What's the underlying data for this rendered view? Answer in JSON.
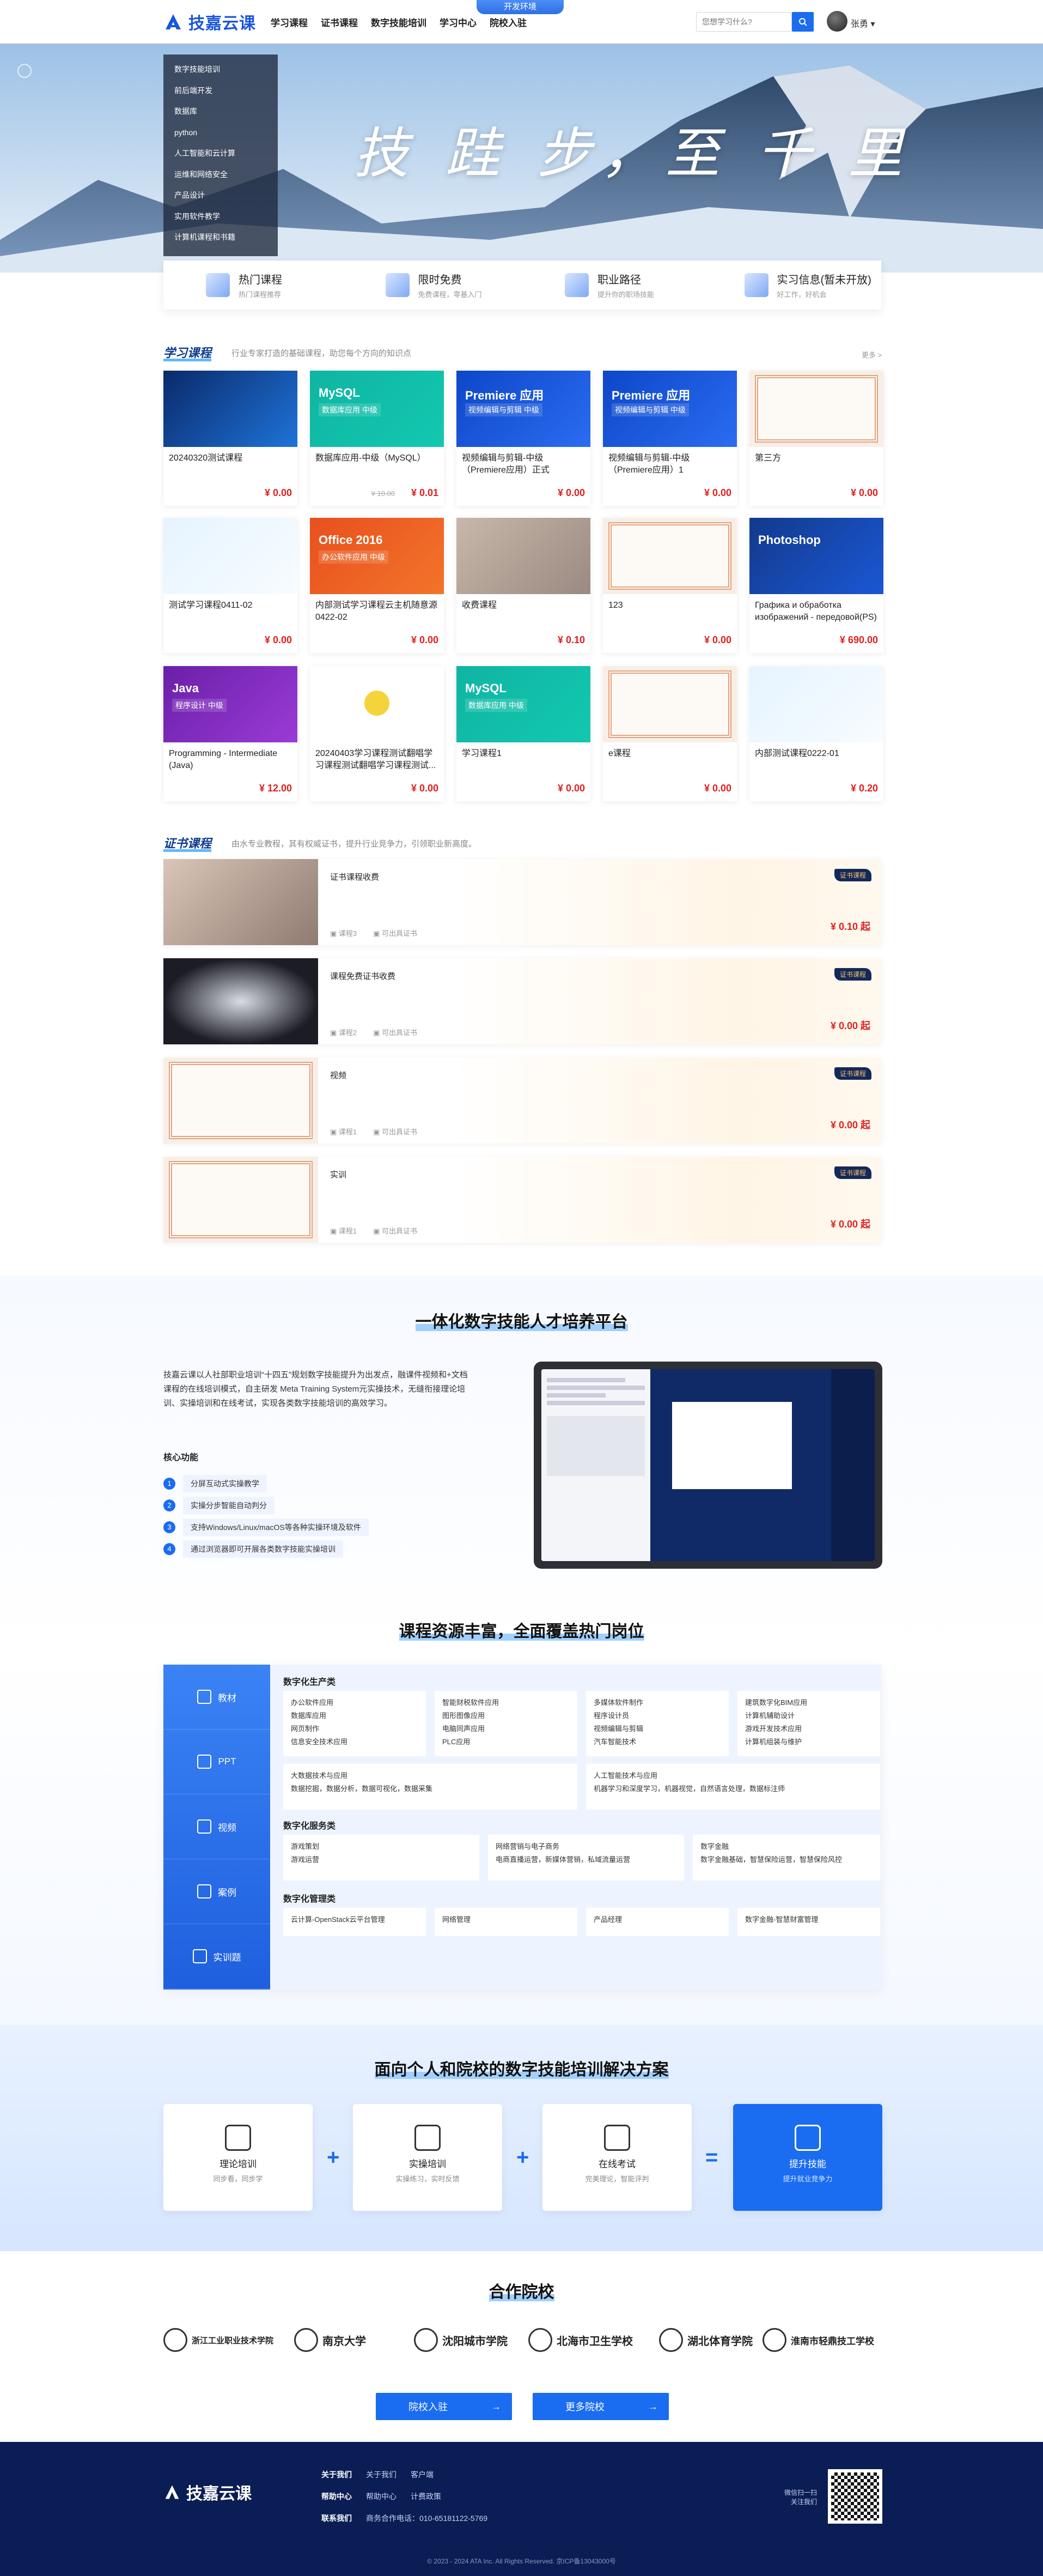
{
  "header": {
    "env_tag": "开发环境",
    "logo_text": "技嘉云课",
    "nav": [
      "学习课程",
      "证书课程",
      "数字技能培训",
      "学习中心",
      "院校入驻"
    ],
    "search_placeholder": "您想学习什么?",
    "user_name": "张勇"
  },
  "banner": {
    "title": "技 跬 步，至 千 里",
    "side_menu": [
      "数字技能培训",
      "前后端开发",
      "数据库",
      "python",
      "人工智能和云计算",
      "运维和网络安全",
      "产品设计",
      "实用软件教学",
      "计算机课程和书籍"
    ]
  },
  "categories": [
    {
      "title": "热门课程",
      "sub": "热门课程推荐"
    },
    {
      "title": "限时免费",
      "sub": "免费课程，零基入门"
    },
    {
      "title": "职业路径",
      "sub": "提升你的职场技能"
    },
    {
      "title": "实习信息(暂未开放)",
      "sub": "好工作，好机会"
    }
  ],
  "study": {
    "title": "学习课程",
    "desc": "行业专家打造的基础课程，助您每个方向的知识点",
    "more": "更多 >",
    "courses": [
      {
        "name": "20240320测试课程",
        "price": "¥ 0.00",
        "thumb": "tech",
        "badge": "",
        "sub": ""
      },
      {
        "name": "数据库应用-中级（MySQL）",
        "price": "¥ 0.01",
        "old": "¥ 10.00",
        "thumb": "teal",
        "badge": "MySQL",
        "sub": "数据库应用 中级"
      },
      {
        "name": "视频编辑与剪辑-中级（Premiere应用）正式",
        "price": "¥ 0.00",
        "thumb": "blue",
        "badge": "Premiere 应用",
        "sub": "视频编辑与剪辑 中级"
      },
      {
        "name": "视频编辑与剪辑-中级（Premiere应用）1",
        "price": "¥ 0.00",
        "thumb": "blue",
        "badge": "Premiere 应用",
        "sub": "视频编辑与剪辑 中级"
      },
      {
        "name": "第三方",
        "price": "¥ 0.00",
        "thumb": "cert",
        "badge": "",
        "sub": ""
      },
      {
        "name": "测试学习课程0411-02",
        "price": "¥ 0.00",
        "thumb": "light",
        "badge": "",
        "sub": ""
      },
      {
        "name": "内部测试学习课程云主机随意源0422-02",
        "price": "¥ 0.00",
        "thumb": "orange",
        "badge": "Office 2016",
        "sub": "办公软件应用 中级"
      },
      {
        "name": "收费课程",
        "price": "¥ 0.10",
        "thumb": "money",
        "badge": "",
        "sub": ""
      },
      {
        "name": "123",
        "price": "¥ 0.00",
        "thumb": "cert",
        "badge": "",
        "sub": ""
      },
      {
        "name": "Графика и обработка изображений - передовой(PS)",
        "price": "¥ 690.00",
        "thumb": "navy",
        "badge": "Photoshop",
        "sub": ""
      },
      {
        "name": "Programming - Intermediate (Java)",
        "price": "¥ 12.00",
        "thumb": "purple",
        "badge": "Java",
        "sub": "程序设计 中级"
      },
      {
        "name": "20240403学习课程测试翻唱学习课程测试翻唱学习课程测试...",
        "price": "¥ 0.00",
        "thumb": "pika",
        "badge": "",
        "sub": ""
      },
      {
        "name": "学习课程1",
        "price": "¥ 0.00",
        "thumb": "teal",
        "badge": "MySQL",
        "sub": "数据库应用 中级"
      },
      {
        "name": "e课程",
        "price": "¥ 0.00",
        "thumb": "cert",
        "badge": "",
        "sub": ""
      },
      {
        "name": "内部测试课程0222-01",
        "price": "¥ 0.20",
        "thumb": "light",
        "badge": "",
        "sub": ""
      }
    ]
  },
  "certs": {
    "title": "证书课程",
    "desc": "由水专业教程，其有权威证书，提升行业竞争力，引领职业新高度。",
    "items": [
      {
        "name": "证书课程收费",
        "price": "¥ 0.10 起",
        "img": "money",
        "lessons": "课程3",
        "tag": "可出具证书"
      },
      {
        "name": "课程免费证书收费",
        "price": "¥ 0.00 起",
        "img": "stage",
        "lessons": "课程2",
        "tag": "可出具证书"
      },
      {
        "name": "视频",
        "price": "¥ 0.00 起",
        "img": "cert",
        "lessons": "课程1",
        "tag": "可出具证书"
      },
      {
        "name": "实训",
        "price": "¥ 0.00 起",
        "img": "cert",
        "lessons": "课程1",
        "tag": "可出具证书"
      }
    ],
    "badge": "证书课程"
  },
  "platform": {
    "heading": "一体化数字技能人才培养平台",
    "text": "技嘉云课以人社部职业培训“十四五”规划数字技能提升为出发点，融课件视频和+文档课程的在线培训模式，自主研发 Meta Training System元实操技术，无缝衔接理论培训、实操培训和在线考试，实现各类数字技能培训的高效学习。",
    "core_title": "核心功能",
    "features": [
      "分屏互动式实操教学",
      "实操分步智能自动判分",
      "支持Windows/Linux/macOS等各种实操环境及软件",
      "通过浏览器即可开展各类数字技能实操培训"
    ]
  },
  "resources": {
    "heading": "课程资源丰富，全面覆盖热门岗位",
    "tabs": [
      "教材",
      "PPT",
      "视频",
      "案例",
      "实训题"
    ],
    "groups": [
      {
        "title": "数字化生产类",
        "cells": [
          [
            "办公软件应用",
            "数据库应用",
            "网页制作",
            "信息安全技术应用"
          ],
          [
            "智能财税软件应用",
            "图形图像应用",
            "电脑同声应用",
            "PLC应用"
          ],
          [
            "多媒体软件制作",
            "程序设计员",
            "视频编辑与剪辑",
            "汽车智能技术"
          ],
          [
            "建筑数字化BIM应用",
            "计算机辅助设计",
            "游戏开发技术应用",
            "计算机组装与维护"
          ],
          [
            "大数据技术与应用",
            "数据挖掘，数据分析，数据可视化，数据采集"
          ],
          [
            "人工智能技术与应用",
            "机器学习和深度学习，机器视觉，自然语言处理，数据标注师"
          ]
        ]
      },
      {
        "title": "数字化服务类",
        "cells": [
          [
            "游戏策划",
            "游戏运营"
          ],
          [
            "网络营销与电子商务",
            "电商直播运营，新媒体营销，私域流量运营"
          ],
          [
            "数字金融",
            "数字金融基础，智慧保险运营，智慧保险风控"
          ]
        ]
      },
      {
        "title": "数字化管理类",
        "cells": [
          [
            "云计算-OpenStack云平台管理"
          ],
          [
            "网络管理"
          ],
          [
            "产品经理"
          ],
          [
            "数字金融-智慧财富管理"
          ]
        ]
      }
    ]
  },
  "solutions": {
    "heading": "面向个人和院校的数字技能培训解决方案",
    "cards": [
      {
        "name": "理论培训",
        "sub": "同步看，同步学"
      },
      {
        "name": "实操培训",
        "sub": "实操练习，实时反馈"
      },
      {
        "name": "在线考试",
        "sub": "完美理论，智能评判"
      },
      {
        "name": "提升技能",
        "sub": "提升就业竞争力"
      }
    ]
  },
  "partners": {
    "heading": "合作院校",
    "items": [
      "浙江工业职业技术学院",
      "南京大学",
      "沈阳城市学院",
      "北海市卫生学校",
      "湖北体育学院",
      "淮南市轻鼎技工学校"
    ],
    "join_btn": "院校入驻",
    "more_btn": "更多院校"
  },
  "footer": {
    "logo": "技嘉云课",
    "rows": [
      {
        "label": "关于我们",
        "links": [
          "关于我们",
          "客户端"
        ]
      },
      {
        "label": "帮助中心",
        "links": [
          "帮助中心",
          "计费政策"
        ]
      },
      {
        "label": "联系我们",
        "links": [
          "商务合作电话：010-65181122-5769"
        ]
      }
    ],
    "wechat": "微信扫一扫",
    "follow": "关注我们",
    "copyright": "© 2023 - 2024 ATA Inc. All Rights Reserved.    京ICP备13043000号"
  },
  "colors": {
    "brand": "#1a6cf0",
    "price": "#e02020",
    "footer": "#0a1d54"
  }
}
